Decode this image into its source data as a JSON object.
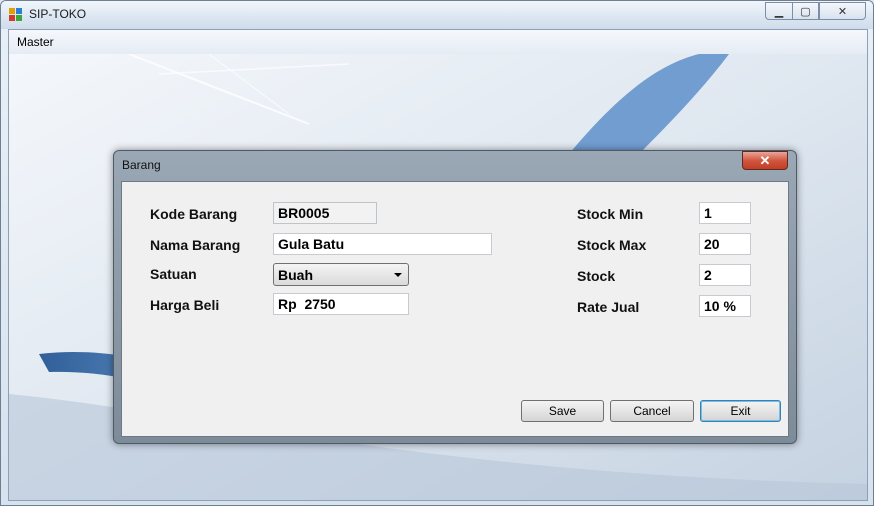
{
  "window": {
    "title": "SIP-TOKO"
  },
  "menu": {
    "items": [
      "Master"
    ]
  },
  "dialog": {
    "title": "Barang",
    "close_symbol": "✕",
    "fields": {
      "kode_label": "Kode Barang",
      "kode_value": "BR0005",
      "nama_label": "Nama Barang",
      "nama_value": "Gula Batu",
      "satuan_label": "Satuan",
      "satuan_value": "Buah",
      "harga_label": "Harga Beli",
      "harga_value": "Rp  2750",
      "stock_min_label": "Stock Min",
      "stock_min_value": "1",
      "stock_max_label": "Stock Max",
      "stock_max_value": "20",
      "stock_label": "Stock",
      "stock_value": "2",
      "rate_label": "Rate Jual",
      "rate_value": "10 %"
    },
    "buttons": {
      "save": "Save",
      "cancel": "Cancel",
      "exit": "Exit"
    }
  },
  "colors": {
    "close_red": "#c9462f",
    "default_border": "#3c7fb1"
  }
}
